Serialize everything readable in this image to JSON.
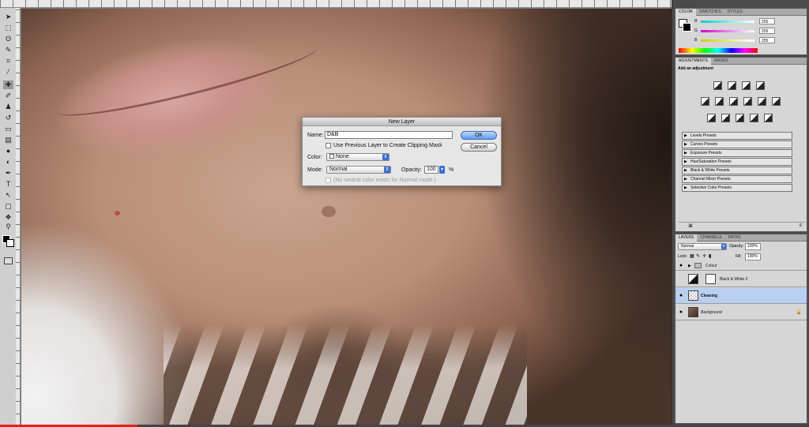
{
  "dialog": {
    "title": "New Layer",
    "name_label": "Name:",
    "name_value": "D&B",
    "clip_label": "Use Previous Layer to Create Clipping Mask",
    "color_label": "Color:",
    "color_value": "None",
    "mode_label": "Mode:",
    "mode_value": "Normal",
    "opacity_label": "Opacity:",
    "opacity_value": "100",
    "opacity_unit": "%",
    "neutral_note": "(No neutral color exists for Normal mode.)",
    "ok_label": "OK",
    "cancel_label": "Cancel"
  },
  "color_panel": {
    "tabs": [
      "COLOR",
      "SWATCHES",
      "STYLES"
    ],
    "channels": [
      {
        "label": "R",
        "value": "255",
        "color": "#00d0d0"
      },
      {
        "label": "G",
        "value": "255",
        "color": "#d000d0"
      },
      {
        "label": "B",
        "value": "255",
        "color": "#d0d000"
      }
    ]
  },
  "adjustments_panel": {
    "tabs": [
      "ADJUSTMENTS",
      "MASKS"
    ],
    "heading": "Add an adjustment",
    "presets": [
      "Levels Presets",
      "Curves Presets",
      "Exposure Presets",
      "Hue/Saturation Presets",
      "Black & White Presets",
      "Channel Mixer Presets",
      "Selective Color Presets"
    ]
  },
  "layers_panel": {
    "tabs": [
      "LAYERS",
      "CHANNELS",
      "PATHS"
    ],
    "blend_mode": "Normal",
    "opacity_label": "Opacity:",
    "opacity_value": "100%",
    "lock_label": "Lock:",
    "fill_label": "Fill:",
    "fill_value": "100%",
    "layers": [
      {
        "name": "Colour",
        "type": "group"
      },
      {
        "name": "Black & White 2",
        "type": "adjustment"
      },
      {
        "name": "Cleaning",
        "type": "pixel",
        "active": true
      },
      {
        "name": "Background",
        "type": "background",
        "locked": true
      }
    ]
  },
  "video_progress": 0.17
}
